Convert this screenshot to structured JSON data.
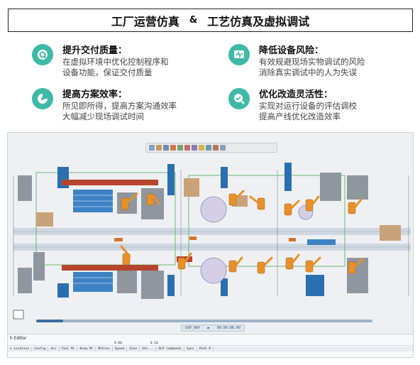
{
  "title": {
    "left": "工厂运营仿真",
    "amp": "&",
    "right": "工艺仿真及虚拟调试"
  },
  "features": [
    {
      "icon": "q-badge-icon",
      "heading": "提升交付质量：",
      "line1": "在虚拟环境中优化控制程序和",
      "line2": "设备功能，保证交付质量"
    },
    {
      "icon": "pulse-monitor-icon",
      "heading": "降低设备风险：",
      "line1": "有效规避现场实物调试的风险",
      "line2": "消除真实调试中的人为失误"
    },
    {
      "icon": "pie-chart-icon",
      "heading": "提高方案效率：",
      "line1": "所见即所得，提高方案沟通效率",
      "line2": "大幅减少现场调试时间"
    },
    {
      "icon": "search-check-icon",
      "heading": "优化改造灵活性：",
      "line1": "实现对运行设备的评估调校",
      "line2": "提高产线优化改造效率"
    }
  ],
  "simulation": {
    "timeline_progress": 0.08,
    "player_label": "DOP_BAY",
    "player_time": "00:00:00.00",
    "editor_title": "h Editor",
    "editor_values": [
      "0.00",
      "0.10"
    ],
    "editor_columns": [
      "n Location",
      "Config",
      "Acc",
      "Tool Mr",
      "Know Mr",
      "Motion",
      "Speed",
      "Zone",
      "Sto...",
      "OLP Commands",
      "Sync",
      "Path #"
    ]
  },
  "colors": {
    "accent": "#3fb9a7",
    "robot": "#e8902a",
    "conveyor": "#2a6fb0",
    "machine_red": "#b7442e"
  }
}
